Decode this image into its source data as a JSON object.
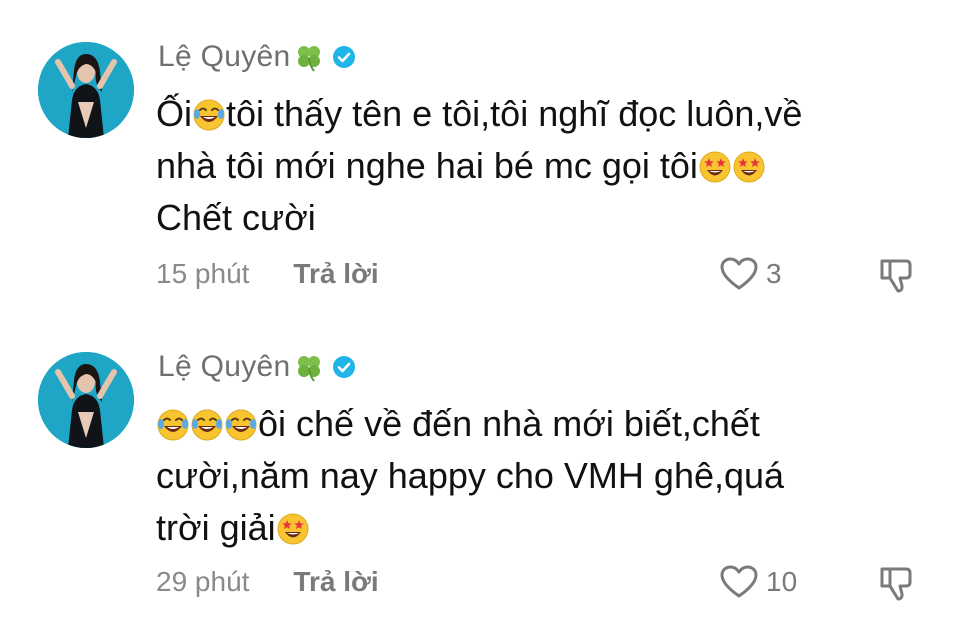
{
  "comments": [
    {
      "author": "Lệ Quyên",
      "author_badges": [
        "four-leaf-clover-emoji",
        "verified-badge-icon"
      ],
      "text_lines": [
        [
          "Ối",
          "{laugh}",
          "tôi thấy tên e tôi,tôi nghĩ đọc luôn,về"
        ],
        [
          "nhà tôi mới nghe hai bé mc gọi tôi",
          "{star}",
          "{star}"
        ],
        [
          "Chết cười"
        ]
      ],
      "time": "15 phút",
      "reply_label": "Trả lời",
      "like_count": "3"
    },
    {
      "author": "Lệ Quyên",
      "author_badges": [
        "four-leaf-clover-emoji",
        "verified-badge-icon"
      ],
      "text_lines": [
        [
          "{laugh}",
          "{laugh}",
          "{laugh}",
          "ôi chế về đến nhà mới biết,chết"
        ],
        [
          "cười,năm nay happy cho VMH ghê,quá"
        ],
        [
          "trời giải",
          "{star}"
        ]
      ],
      "time": "29 phút",
      "reply_label": "Trả lời",
      "like_count": "10"
    }
  ],
  "emoji_map": {
    "{laugh}": "face-with-tears-of-joy-emoji",
    "{star}": "star-struck-emoji"
  },
  "colors": {
    "avatar_bg": "#1fa6c7",
    "verified": "#20b5e8",
    "clover": "#7cbf4a",
    "emoji_yellow": "#f8c531",
    "emoji_tear": "#5aa9e6",
    "emoji_star": "#e8373c",
    "name": "#6f6f6f",
    "meta": "#8a8a8a"
  }
}
